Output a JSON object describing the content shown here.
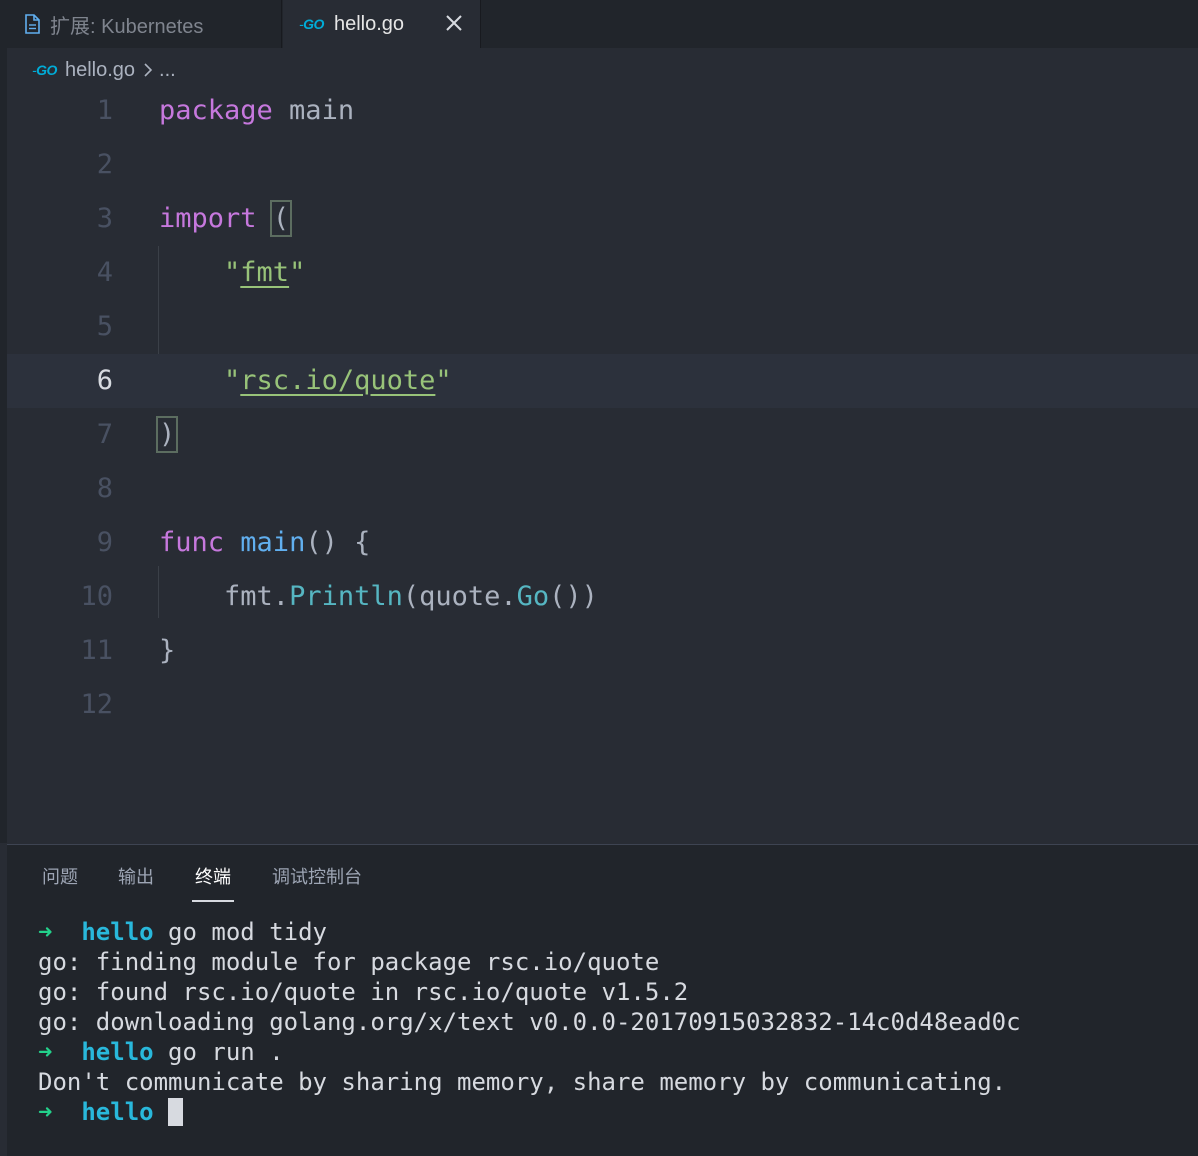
{
  "tabs": [
    {
      "label": "扩展: Kubernetes",
      "icon": "file-icon",
      "active": false
    },
    {
      "label": "hello.go",
      "icon": "go-file-icon",
      "active": true,
      "close": "close-icon"
    }
  ],
  "go_logo": "GO",
  "breadcrumb": {
    "file": "hello.go",
    "rest": "..."
  },
  "editor": {
    "current_line": 6,
    "line_numbers": [
      "1",
      "2",
      "3",
      "4",
      "5",
      "6",
      "7",
      "8",
      "9",
      "10",
      "11",
      "12"
    ],
    "lines": {
      "l1_kw": "package",
      "l1_rest": " main",
      "l3_kw": "import",
      "l3_sp": " ",
      "l3_paren": "(",
      "l4_indent": "    ",
      "l4_q1": "\"",
      "l4_pkg": "fmt",
      "l4_q2": "\"",
      "l6_indent": "    ",
      "l6_q1": "\"",
      "l6_pkg": "rsc.io/quote",
      "l6_q2": "\"",
      "l7_paren": ")",
      "l9_kw": "func",
      "l9_sp": " ",
      "l9_fn": "main",
      "l9_rest": "() {",
      "l10_indent": "    ",
      "l10_obj": "fmt.",
      "l10_method": "Println",
      "l10_mid": "(quote.",
      "l10_method2": "Go",
      "l10_end": "())",
      "l11": "}"
    }
  },
  "panel": {
    "tabs": [
      "问题",
      "输出",
      "终端",
      "调试控制台"
    ],
    "active_tab": "终端"
  },
  "terminal": {
    "arrow": "➜",
    "dir": "hello",
    "cmd1": " go mod tidy",
    "out1": "go: finding module for package rsc.io/quote",
    "out2": "go: found rsc.io/quote in rsc.io/quote v1.5.2",
    "out3": "go: downloading golang.org/x/text v0.0.0-20170915032832-14c0d48ead0c",
    "cmd2": " go run .",
    "out4": "Don't communicate by sharing memory, share memory by communicating."
  }
}
